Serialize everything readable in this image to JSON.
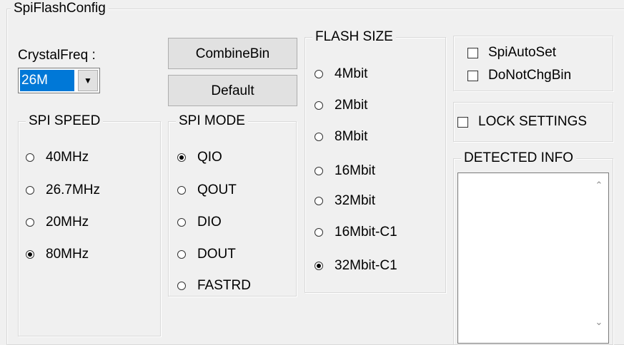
{
  "window": {
    "group_title": "SpiFlashConfig"
  },
  "crystal": {
    "label": "CrystalFreq :",
    "value": "26M"
  },
  "buttons": {
    "combine": "CombineBin",
    "default": "Default"
  },
  "spi_speed": {
    "title": "SPI SPEED",
    "options": [
      "40MHz",
      "26.7MHz",
      "20MHz",
      "80MHz"
    ],
    "selected": "80MHz"
  },
  "spi_mode": {
    "title": "SPI MODE",
    "options": [
      "QIO",
      "QOUT",
      "DIO",
      "DOUT",
      "FASTRD"
    ],
    "selected": "QIO"
  },
  "flash_size": {
    "title": "FLASH SIZE",
    "options": [
      "4Mbit",
      "2Mbit",
      "8Mbit",
      "16Mbit",
      "32Mbit",
      "16Mbit-C1",
      "32Mbit-C1"
    ],
    "selected": "32Mbit-C1"
  },
  "options": {
    "spi_auto_set": "SpiAutoSet",
    "do_not_chg_bin": "DoNotChgBin"
  },
  "lock": {
    "label": "LOCK SETTINGS"
  },
  "detected": {
    "title": "DETECTED INFO"
  },
  "icons": {
    "scroll_up": "chevron-up-icon",
    "scroll_down": "chevron-down-icon",
    "dropdown": "caret-down-icon"
  }
}
